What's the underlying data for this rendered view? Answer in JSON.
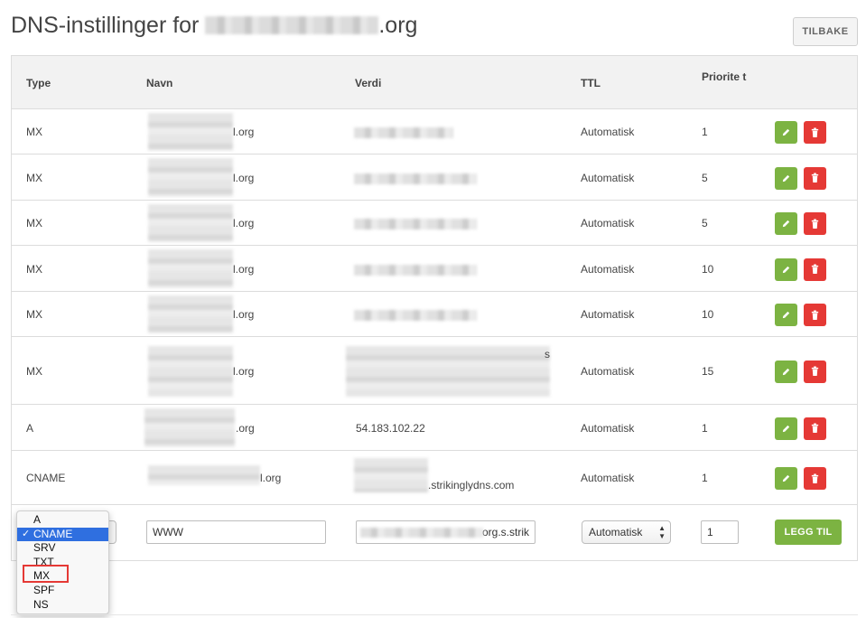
{
  "header": {
    "title_prefix": "DNS-instillinger for ",
    "title_suffix": ".org",
    "back_label": "TILBAKE"
  },
  "table": {
    "columns": {
      "type": "Type",
      "name": "Navn",
      "value": "Verdi",
      "ttl": "TTL",
      "priority": "Priorite t"
    },
    "rows": [
      {
        "type": "MX",
        "name_suffix": "l.org",
        "value_suffix": "",
        "ttl": "Automatisk",
        "priority": "1"
      },
      {
        "type": "MX",
        "name_suffix": "l.org",
        "value_suffix": "",
        "ttl": "Automatisk",
        "priority": "5"
      },
      {
        "type": "MX",
        "name_suffix": "l.org",
        "value_suffix": "",
        "ttl": "Automatisk",
        "priority": "5"
      },
      {
        "type": "MX",
        "name_suffix": "l.org",
        "value_suffix": "",
        "ttl": "Automatisk",
        "priority": "10"
      },
      {
        "type": "MX",
        "name_suffix": "l.org",
        "value_suffix": "",
        "ttl": "Automatisk",
        "priority": "10"
      },
      {
        "type": "MX",
        "name_suffix": "l.org",
        "value_suffix": "s",
        "ttl": "Automatisk",
        "priority": "15"
      },
      {
        "type": "A",
        "name_suffix": ".org",
        "value_suffix": "54.183.102.22",
        "ttl": "Automatisk",
        "priority": "1"
      },
      {
        "type": "CNAME",
        "name_suffix": "l.org",
        "value_suffix": ".strikinglydns.com",
        "ttl": "Automatisk",
        "priority": "1"
      }
    ]
  },
  "new_record": {
    "name_value": "WWW",
    "value_suffix": "org.s.strik",
    "ttl_value": "Automatisk",
    "priority_value": "1",
    "add_label": "LEGG TIL"
  },
  "type_dropdown": {
    "options": [
      "A",
      "CNAME",
      "SRV",
      "TXT",
      "MX",
      "SPF",
      "NS"
    ],
    "selected": "CNAME",
    "highlighted": "MX"
  },
  "colors": {
    "edit": "#7cb342",
    "delete": "#e53935",
    "select_highlight": "#2f6fe0"
  }
}
